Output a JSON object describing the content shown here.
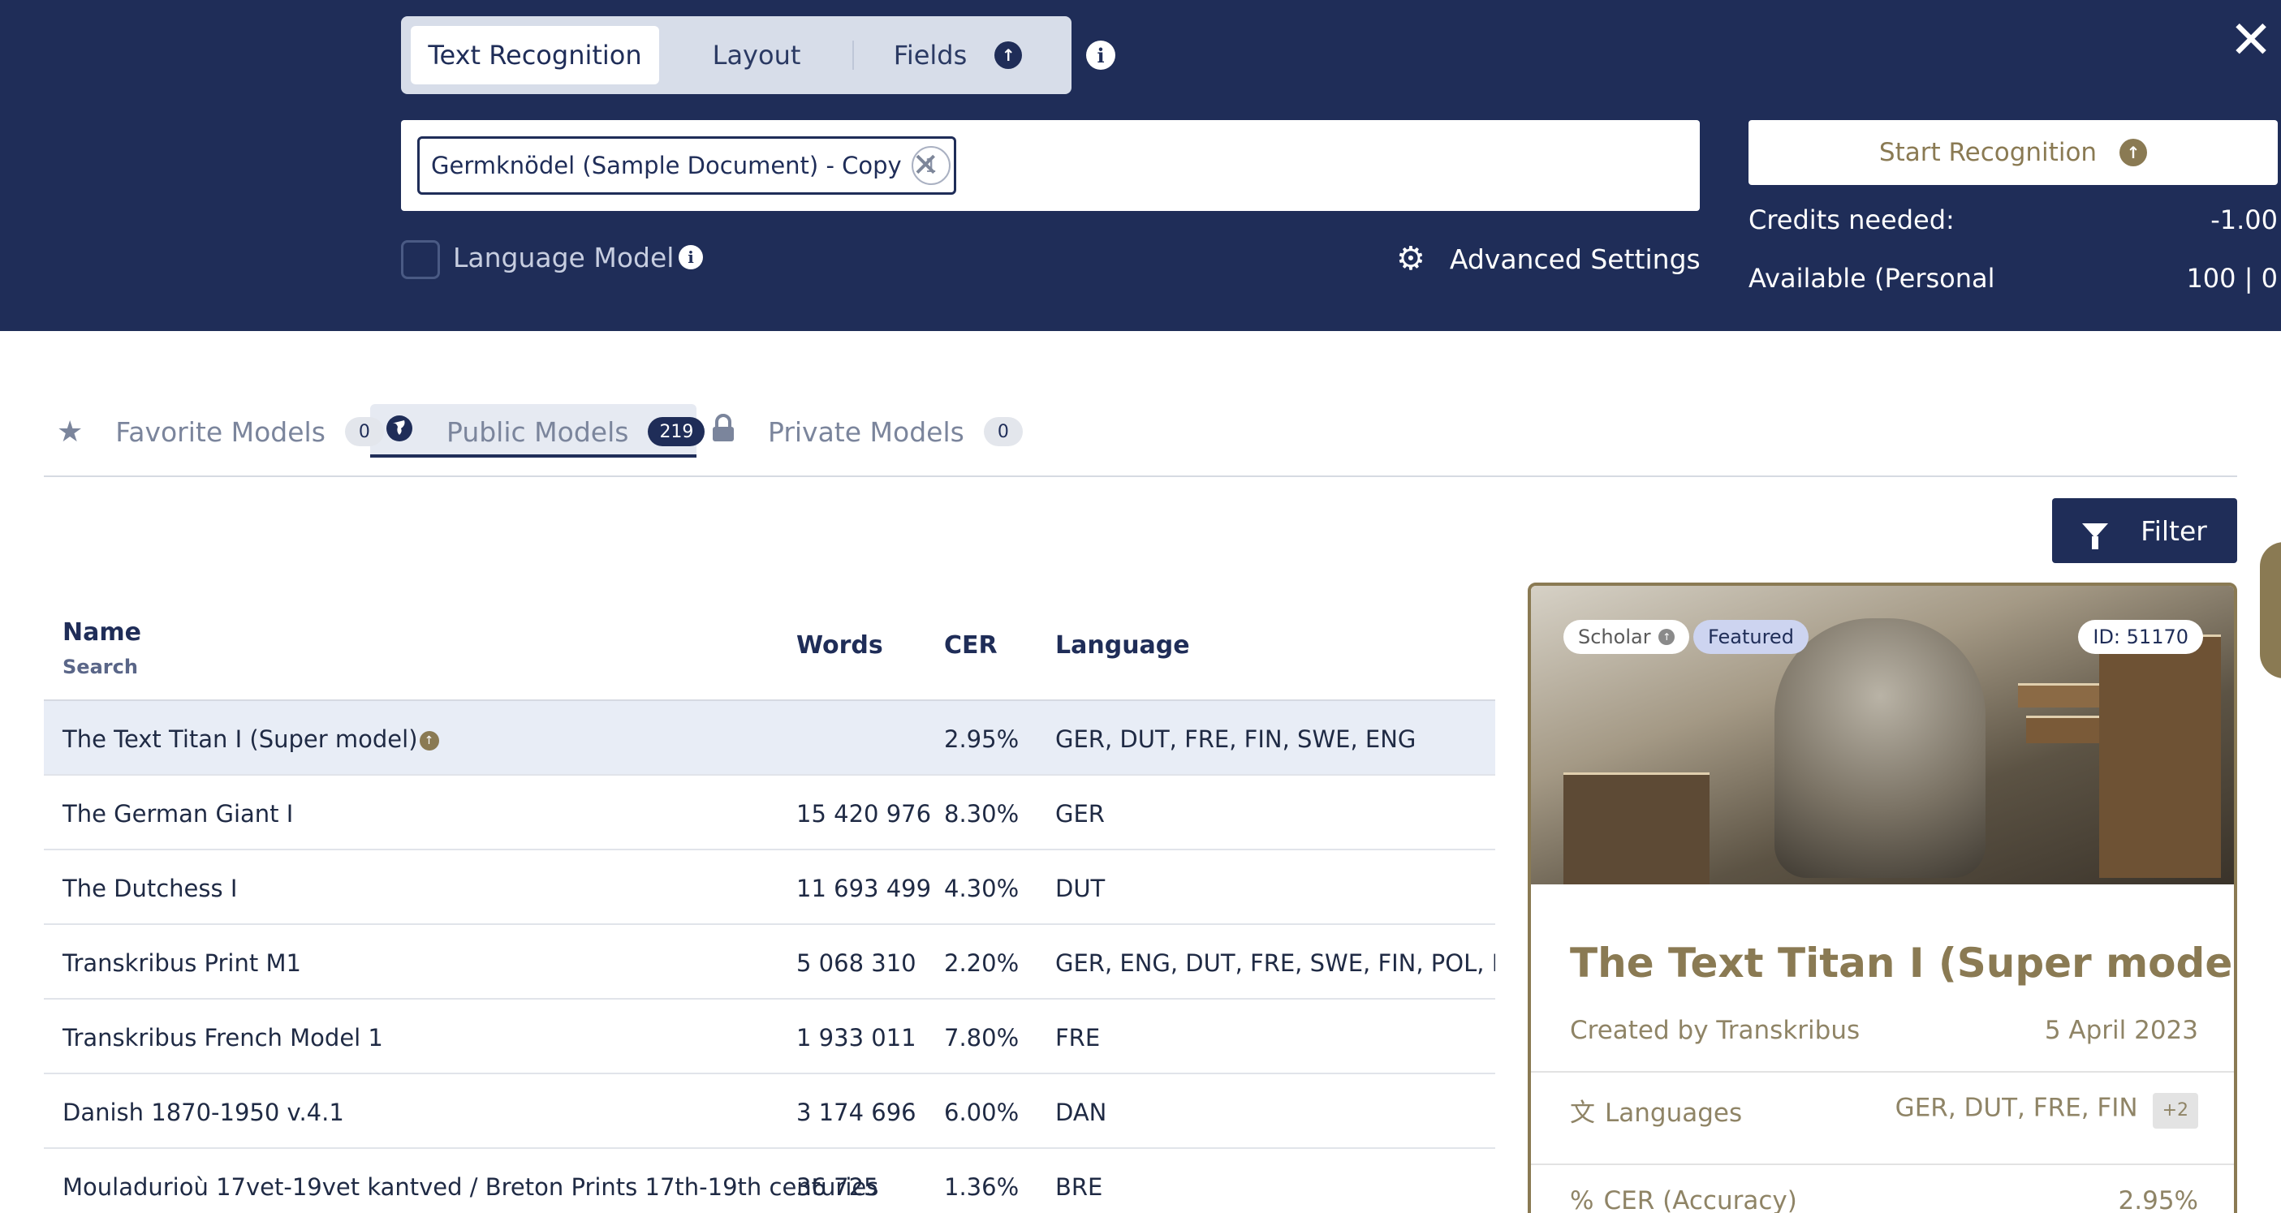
{
  "header": {
    "mode_tabs": [
      {
        "label": "Text Recognition",
        "active": true
      },
      {
        "label": "Layout",
        "active": false
      },
      {
        "label": "Fields",
        "active": false
      }
    ],
    "document_chip": {
      "label": "Germknödel (Sample Document) - Copy",
      "count": "1"
    },
    "language_model_label": "Language Model",
    "advanced_settings_label": "Advanced Settings",
    "start_button_label": "Start Recognition",
    "credits_needed_label": "Credits needed:",
    "credits_needed_value": "-1.00",
    "available_label": "Available (Personal",
    "available_value": "100 | 0"
  },
  "model_tabs": [
    {
      "label": "Favorite Models",
      "count": "0",
      "icon": "star-icon"
    },
    {
      "label": "Public Models",
      "count": "219",
      "icon": "globe-icon",
      "active": true
    },
    {
      "label": "Private Models",
      "count": "0",
      "icon": "lock-icon"
    }
  ],
  "filter_label": "Filter",
  "table": {
    "columns": {
      "name": "Name",
      "name_sub": "Search",
      "words": "Words",
      "cer": "CER",
      "language": "Language"
    },
    "rows": [
      {
        "name": "The Text Titan I (Super model)",
        "words": "",
        "cer": "2.95%",
        "language": "GER, DUT, FRE, FIN, SWE, ENG",
        "selected": true
      },
      {
        "name": "The German Giant I",
        "words": "15 420 976",
        "cer": "8.30%",
        "language": "GER"
      },
      {
        "name": "The Dutchess I",
        "words": "11 693 499",
        "cer": "4.30%",
        "language": "DUT"
      },
      {
        "name": "Transkribus Print M1",
        "words": "5 068 310",
        "cer": "2.20%",
        "language": "GER, ENG, DUT, FRE, SWE, FIN, POL, ITA, SPA"
      },
      {
        "name": "Transkribus French Model 1",
        "words": "1 933 011",
        "cer": "7.80%",
        "language": "FRE"
      },
      {
        "name": "Danish 1870-1950 v.4.1",
        "words": "3 174 696",
        "cer": "6.00%",
        "language": "DAN"
      },
      {
        "name": "Mouladurioù 17vet-19vet kantved / Breton Prints 17th-19th centuries",
        "words": "36 725",
        "cer": "1.36%",
        "language": "BRE"
      }
    ]
  },
  "card": {
    "badges": {
      "scholar": "Scholar",
      "featured": "Featured",
      "id": "ID: 51170"
    },
    "title": "The Text Titan I (Super model)",
    "created_by": "Created by Transkribus",
    "date": "5 April 2023",
    "languages_label": "Languages",
    "languages_value": "GER, DUT, FRE, FIN",
    "languages_more": "+2",
    "cer_label": "CER (Accuracy)",
    "cer_value": "2.95%"
  },
  "colors": {
    "navy": "#1f2d58",
    "gold": "#8a7a53",
    "selected_row": "#e8edf6"
  }
}
